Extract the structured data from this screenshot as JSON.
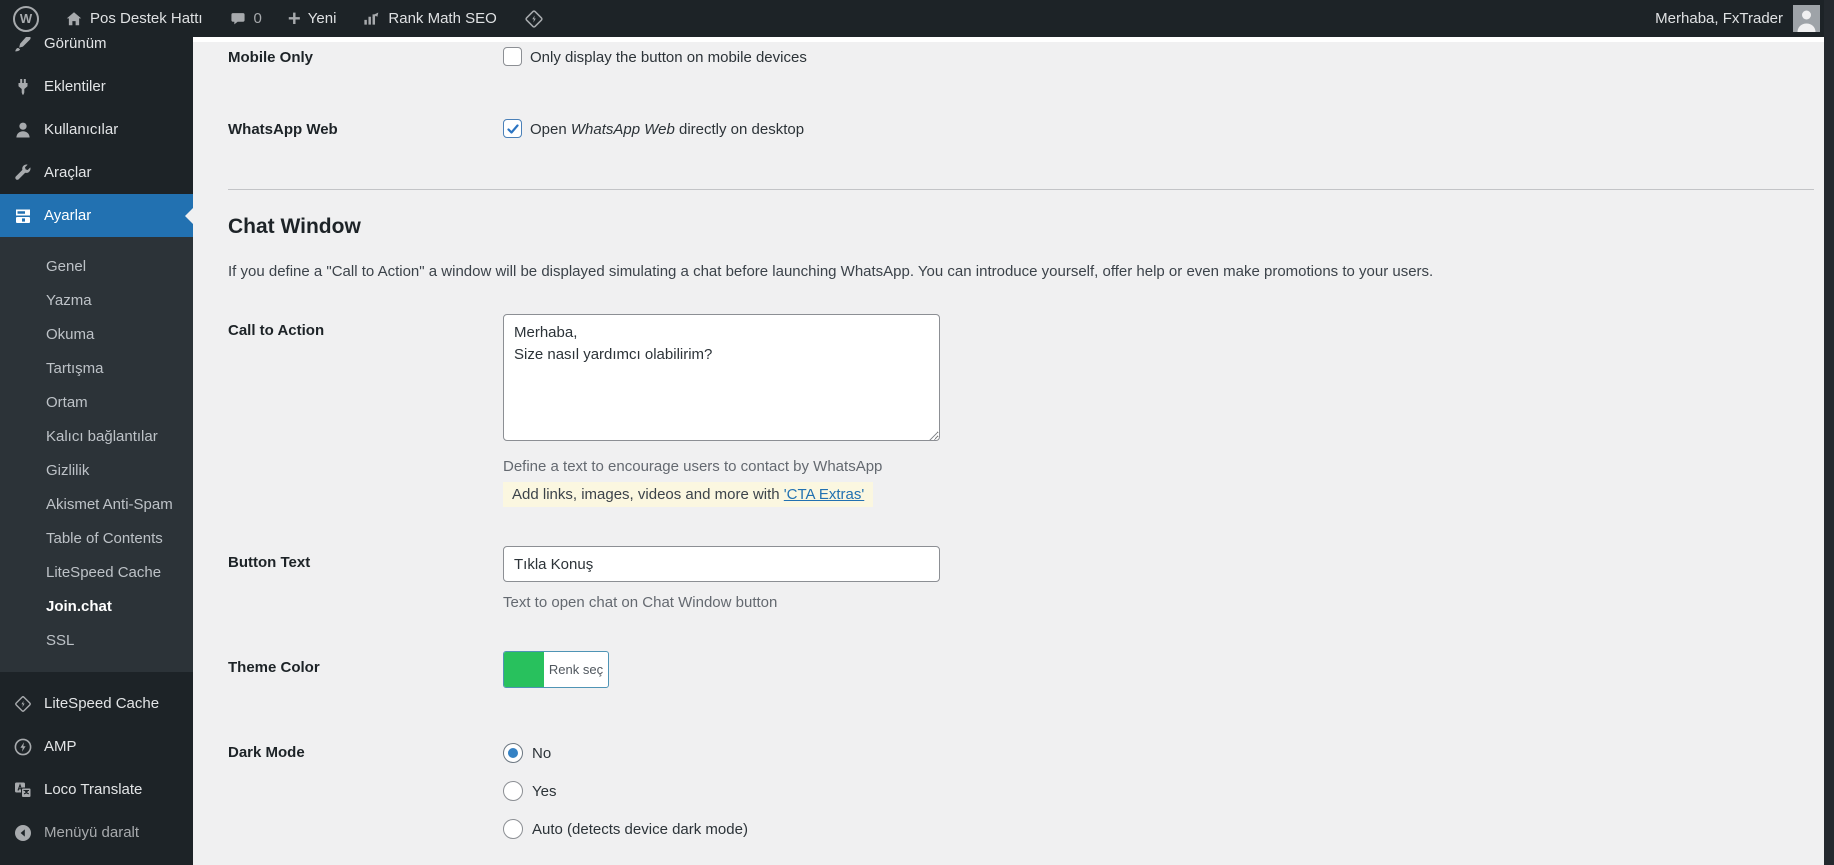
{
  "topbar": {
    "site_name": "Pos Destek Hattı",
    "comments_count": "0",
    "new_label": "Yeni",
    "rankmath_label": "Rank Math SEO",
    "greeting": "Merhaba, FxTrader"
  },
  "sidebar": {
    "items": [
      {
        "label": "Görünüm"
      },
      {
        "label": "Eklentiler"
      },
      {
        "label": "Kullanıcılar"
      },
      {
        "label": "Araçlar"
      },
      {
        "label": "Ayarlar",
        "active": true
      }
    ],
    "submenu": [
      {
        "label": "Genel"
      },
      {
        "label": "Yazma"
      },
      {
        "label": "Okuma"
      },
      {
        "label": "Tartışma"
      },
      {
        "label": "Ortam"
      },
      {
        "label": "Kalıcı bağlantılar"
      },
      {
        "label": "Gizlilik"
      },
      {
        "label": "Akismet Anti-Spam"
      },
      {
        "label": "Table of Contents"
      },
      {
        "label": "LiteSpeed Cache"
      },
      {
        "label": "Join.chat",
        "current": true
      },
      {
        "label": "SSL"
      }
    ],
    "bottom_items": [
      {
        "label": "LiteSpeed Cache"
      },
      {
        "label": "AMP"
      },
      {
        "label": "Loco Translate"
      },
      {
        "label": "Menüyü daralt"
      }
    ]
  },
  "settings": {
    "mobile_only": {
      "label": "Mobile Only",
      "checkbox_label": "Only display the button on mobile devices",
      "checked": false
    },
    "whatsapp_web": {
      "label": "WhatsApp Web",
      "checkbox_label_prefix": "Open ",
      "checkbox_label_italic": "WhatsApp Web",
      "checkbox_label_suffix": " directly on desktop",
      "checked": true
    },
    "section": {
      "title": "Chat Window",
      "description": "If you define a \"Call to Action\" a window will be displayed simulating a chat before launching WhatsApp. You can introduce yourself, offer help or even make promotions to your users."
    },
    "cta": {
      "label": "Call to Action",
      "value": "Merhaba,\nSize nasıl yardımcı olabilirim?",
      "helper": "Define a text to encourage users to contact by WhatsApp",
      "note_text": "Add links, images, videos and more with ",
      "note_link": "'CTA Extras'"
    },
    "button_text": {
      "label": "Button Text",
      "value": "Tıkla Konuş",
      "helper": "Text to open chat on Chat Window button"
    },
    "theme_color": {
      "label": "Theme Color",
      "button_label": "Renk seç",
      "swatch_color": "#28c15d",
      "swatch_style": "background:#28c15d"
    },
    "dark_mode": {
      "label": "Dark Mode",
      "options": [
        {
          "label": "No",
          "selected": true
        },
        {
          "label": "Yes",
          "selected": false
        },
        {
          "label": "Auto (detects device dark mode)",
          "selected": false
        }
      ]
    }
  },
  "colors": {
    "admin_bar_bg": "#1d2327",
    "active_menu_bg": "#2271b1",
    "link": "#2271b1",
    "note_bg": "#fbf7e0",
    "theme_swatch": "#28c15d",
    "radio_dot": "#3582c4"
  }
}
